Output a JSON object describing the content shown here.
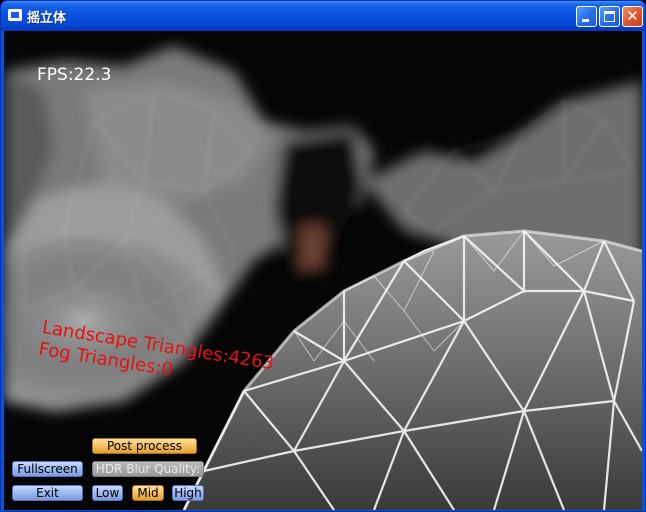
{
  "window": {
    "title": "摇立体"
  },
  "hud": {
    "fps": "FPS:22.3",
    "landscape_triangles": "Landscape Triangles:4263",
    "fog_triangles": "Fog Triangles:0"
  },
  "controls": {
    "post_process": "Post process",
    "fullscreen": "Fullscreen",
    "hdr_blur_quality": "HDR Blur Quality:",
    "exit": "Exit",
    "quality_low": "Low",
    "quality_mid": "Mid",
    "quality_high": "High",
    "selected_quality": "Mid"
  },
  "colors": {
    "titlebar": "#0a54e0",
    "overlay_text": "#e81010",
    "button_blue": "#9cb8f0",
    "button_orange": "#f4c060",
    "button_gray": "#999999"
  },
  "icons": {
    "app": "window-app-icon",
    "minimize": "minimize-icon",
    "maximize": "maximize-icon",
    "close": "close-icon"
  }
}
